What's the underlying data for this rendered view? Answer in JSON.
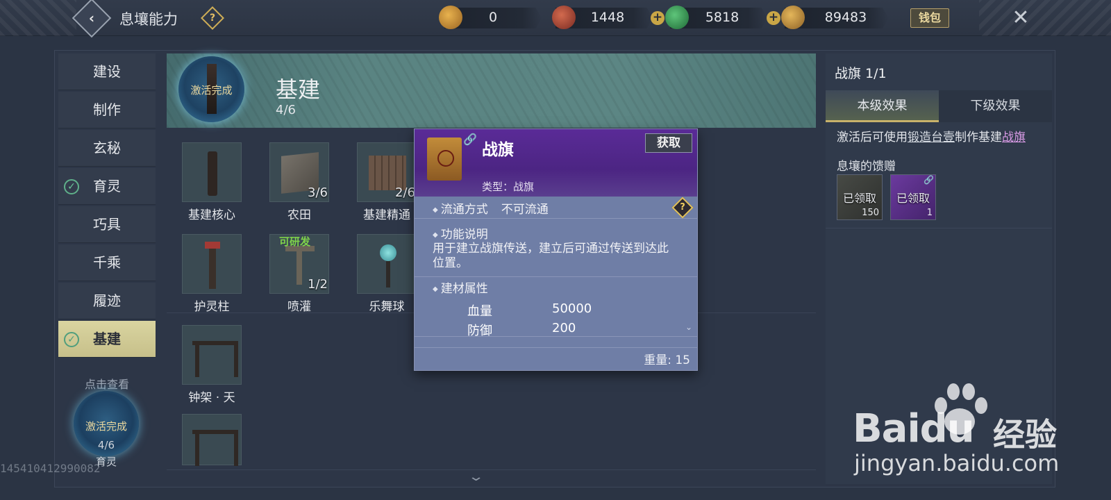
{
  "topbar": {
    "title": "息壤能力",
    "currencies": [
      {
        "icon": "gourd-coin-icon",
        "value": "0",
        "color": "#d69a3a",
        "has_plus": false
      },
      {
        "icon": "red-bead-icon",
        "value": "1448",
        "color": "#b5473a",
        "has_plus": true
      },
      {
        "icon": "jade-coin-icon",
        "value": "5818",
        "color": "#3e9a52",
        "has_plus": true
      },
      {
        "icon": "gold-ingot-icon",
        "value": "89483",
        "color": "#c99a3e",
        "has_plus": false
      }
    ],
    "wallet_label": "钱包"
  },
  "left_nav": {
    "items": [
      {
        "label": "建设",
        "checked": false,
        "active": false
      },
      {
        "label": "制作",
        "checked": false,
        "active": false
      },
      {
        "label": "玄秘",
        "checked": false,
        "active": false
      },
      {
        "label": "育灵",
        "checked": true,
        "active": false
      },
      {
        "label": "巧具",
        "checked": false,
        "active": false
      },
      {
        "label": "千乘",
        "checked": false,
        "active": false
      },
      {
        "label": "履迹",
        "checked": false,
        "active": false
      },
      {
        "label": "基建",
        "checked": true,
        "active": true
      }
    ],
    "view_hint": "点击查看",
    "badge": {
      "label": "激活完成",
      "progress": "4/6",
      "name": "育灵"
    }
  },
  "id_watermark": "145410412990082",
  "banner": {
    "badge_label": "激活完成",
    "title": "基建",
    "progress": "4/6"
  },
  "grid": {
    "items": [
      {
        "name": "基建核心",
        "count": "",
        "tag": "",
        "shape": "totem"
      },
      {
        "name": "农田",
        "count": "3/6",
        "tag": "",
        "shape": "box"
      },
      {
        "name": "基建精通",
        "count": "2/6",
        "tag": "",
        "shape": "crate"
      },
      {
        "name": "护灵柱",
        "count": "",
        "tag": "",
        "shape": "pillar"
      },
      {
        "name": "喷灌",
        "count": "1/2",
        "tag": "可研发",
        "shape": "sprinkler"
      },
      {
        "name": "乐舞球",
        "count": "",
        "tag": "",
        "shape": "orb"
      },
      {
        "name": "钟架 · 天",
        "count": "",
        "tag": "",
        "shape": "rack"
      },
      {
        "name": "",
        "count": "",
        "tag": "",
        "shape": "rack"
      }
    ]
  },
  "popup": {
    "title": "战旗",
    "obtain_label": "获取",
    "type": "类型：战旗",
    "circulation_label": "流通方式",
    "circulation_value": "不可流通",
    "function_label": "功能说明",
    "function_text": "用于建立战旗传送，建立后可通过传送到达此位置。",
    "material_label": "建材属性",
    "stats": [
      {
        "label": "血量",
        "value": "50000"
      },
      {
        "label": "防御",
        "value": "200"
      }
    ],
    "weight": "重量: 15"
  },
  "right_panel": {
    "title": "战旗 1/1",
    "tabs": [
      {
        "label": "本级效果",
        "active": true
      },
      {
        "label": "下级效果",
        "active": false
      }
    ],
    "desc_prefix": "激活后可使用",
    "desc_link": "锻造台壹",
    "desc_mid": "制作基建",
    "desc_highlight": "战旗",
    "gift_label": "息壤的馈赠",
    "rewards": [
      {
        "label": "已领取",
        "count": "150",
        "rarity_color": "#3a3f3c"
      },
      {
        "label": "已领取",
        "count": "1",
        "rarity_color": "#5a2b8e"
      }
    ]
  },
  "watermark": {
    "brand": "Baidu",
    "brand_cn": "经验",
    "url": "jingyan.baidu.com"
  }
}
